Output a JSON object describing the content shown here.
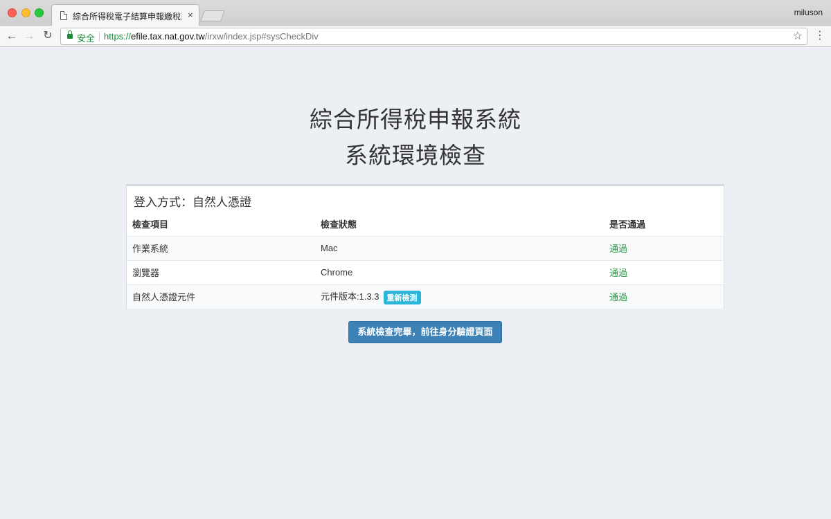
{
  "browser": {
    "tab_title": "綜合所得稅電子結算申報繳稅系統",
    "tab_close": "×",
    "profile_name": "miluson",
    "secure_label": "安全",
    "url_scheme": "https://",
    "url_host": "efile.tax.nat.gov.tw",
    "url_path": "/irxw/index.jsp#sysCheckDiv",
    "icons": {
      "back": "back-arrow-icon",
      "forward": "forward-arrow-icon",
      "reload": "reload-icon",
      "lock": "lock-icon",
      "star": "star-icon",
      "menu": "kebab-menu-icon"
    }
  },
  "page": {
    "title": "綜合所得稅申報系統",
    "subtitle": "系統環境檢查",
    "login_method": "登入方式：自然人憑證",
    "table": {
      "headers": [
        "檢查項目",
        "檢查狀態",
        "是否通過"
      ],
      "rows": [
        {
          "item": "作業系統",
          "status": "Mac",
          "result": "通過"
        },
        {
          "item": "瀏覽器",
          "status": "Chrome",
          "result": "通過"
        },
        {
          "item": "自然人憑證元件",
          "status": "元件版本:1.3.3",
          "result": "通過",
          "action": "重新檢測"
        }
      ]
    },
    "primary_button": "系統檢查完畢，前往身分驗證頁面"
  },
  "colors": {
    "background": "#eceff4",
    "pass": "#2e9e4b",
    "recheck_button": "#2bb6d9",
    "primary_button": "#3c82b7",
    "secure": "#1b8a3a"
  }
}
